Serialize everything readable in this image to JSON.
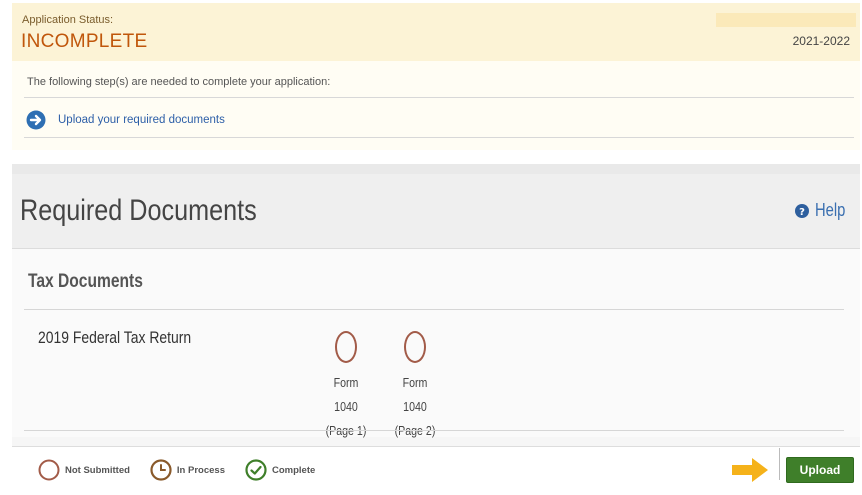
{
  "application_status": {
    "label": "Application Status:",
    "value": "INCOMPLETE",
    "year": "2021-2022",
    "steps_intro": "The following step(s) are needed to complete your application:",
    "steps": [
      {
        "label": "Upload your required documents",
        "icon": "arrow-right-circle-icon"
      }
    ]
  },
  "required_documents": {
    "title": "Required Documents",
    "help_label": "Help",
    "sections": [
      {
        "title": "Tax Documents",
        "documents": [
          {
            "name": "2019 Federal Tax Return",
            "forms": [
              {
                "line1": "Form 1040",
                "line2": "(Page 1)",
                "status": "not-submitted"
              },
              {
                "line1": "Form 1040",
                "line2": "(Page 2)",
                "status": "not-submitted"
              }
            ]
          }
        ]
      }
    ]
  },
  "legend": [
    {
      "label": "Not Submitted",
      "icon": "empty-circle-icon",
      "color": "#a25b48"
    },
    {
      "label": "In Process",
      "icon": "clock-icon",
      "color": "#8a5a2b"
    },
    {
      "label": "Complete",
      "icon": "check-circle-icon",
      "color": "#3f7f2a"
    }
  ],
  "upload": {
    "label": "Upload",
    "color": "#3f7f2a"
  },
  "colors": {
    "status_header_bg": "#fcf3d6",
    "status_text": "#c0560b",
    "link": "#2d5fa8",
    "arrow_highlight": "#f5b21a"
  }
}
